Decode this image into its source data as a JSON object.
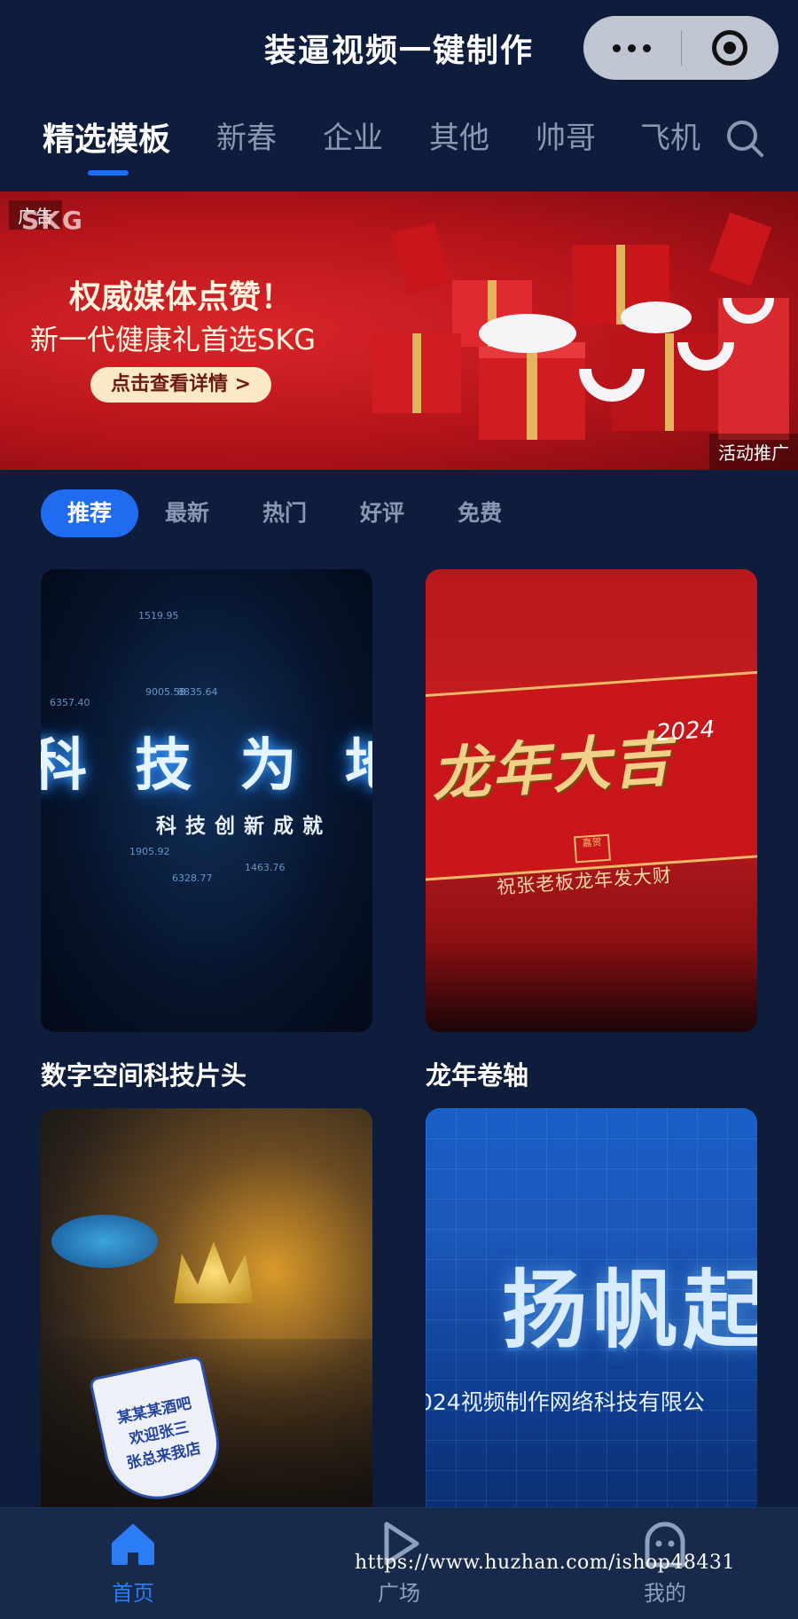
{
  "header": {
    "title": "装逼视频一键制作"
  },
  "category_tabs": [
    {
      "label": "精选模板",
      "active": true
    },
    {
      "label": "新春",
      "active": false
    },
    {
      "label": "企业",
      "active": false
    },
    {
      "label": "其他",
      "active": false
    },
    {
      "label": "帅哥",
      "active": false
    },
    {
      "label": "飞机",
      "active": false
    }
  ],
  "banner": {
    "badge": "广告",
    "brand": "SKG",
    "headline": "权威媒体点赞！",
    "subline": "新一代健康礼首选SKG",
    "cta": "点击查看详情 >",
    "tag": "活动推广"
  },
  "filters": [
    {
      "label": "推荐",
      "active": true
    },
    {
      "label": "最新",
      "active": false
    },
    {
      "label": "热门",
      "active": false
    },
    {
      "label": "好评",
      "active": false
    },
    {
      "label": "免费",
      "active": false
    }
  ],
  "templates": [
    {
      "title": "数字空间科技片头",
      "thumb_text": "科 技 为 地 创",
      "thumb_sub": "科技创新成就",
      "numbers": [
        "9005.58",
        "8835.64",
        "6357.40",
        "1905.92",
        "6328.77",
        "1463.76",
        "1519.95"
      ]
    },
    {
      "title": "龙年卷轴",
      "thumb_text": "龙年大吉",
      "thumb_year": "2024",
      "thumb_seal": "嘉贺",
      "thumb_sub": "祝张老板龙年发大财"
    },
    {
      "title": "",
      "thumb_sign_lines": [
        "某某某酒吧",
        "欢迎张三",
        "张总来我店"
      ]
    },
    {
      "title": "",
      "thumb_text": "扬帆起",
      "thumb_sub": "024视频制作网络科技有限公"
    }
  ],
  "bottom_nav": [
    {
      "label": "首页",
      "icon": "home-icon",
      "active": true
    },
    {
      "label": "广场",
      "icon": "play-icon",
      "active": false
    },
    {
      "label": "我的",
      "icon": "ghost-icon",
      "active": false
    }
  ],
  "watermark": "https://www.huzhan.com/ishop48431",
  "colors": {
    "background": "#0e1d3c",
    "accent": "#1f6cf0",
    "inactive_text": "#8a97b4"
  }
}
